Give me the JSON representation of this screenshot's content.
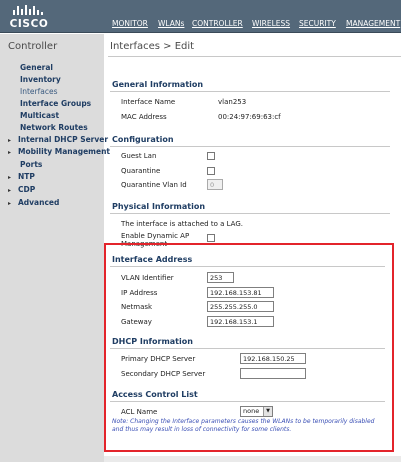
{
  "brand": {
    "logo_text": "CISCO"
  },
  "nav": {
    "items": [
      {
        "label": "MONITOR",
        "name": "nav-monitor"
      },
      {
        "label": "WLANs",
        "name": "nav-wlans"
      },
      {
        "label": "CONTROLLER",
        "name": "nav-controller"
      },
      {
        "label": "WIRELESS",
        "name": "nav-wireless"
      },
      {
        "label": "SECURITY",
        "name": "nav-security"
      },
      {
        "label": "MANAGEMENT",
        "name": "nav-management"
      }
    ]
  },
  "sidebar": {
    "title": "Controller",
    "items": [
      {
        "label": "General"
      },
      {
        "label": "Inventory"
      },
      {
        "label": "Interfaces"
      },
      {
        "label": "Interface Groups"
      },
      {
        "label": "Multicast"
      },
      {
        "label": "Network Routes"
      },
      {
        "label": "Internal DHCP Server",
        "expandable": true
      },
      {
        "label": "Mobility Management",
        "expandable": true
      },
      {
        "label": "Ports"
      },
      {
        "label": "NTP",
        "expandable": true
      },
      {
        "label": "CDP",
        "expandable": true
      },
      {
        "label": "Advanced",
        "expandable": true
      }
    ],
    "expand_glyph": "▸"
  },
  "page": {
    "title": "Interfaces > Edit"
  },
  "general": {
    "title": "General Information",
    "interface_name_label": "Interface Name",
    "interface_name_value": "vlan253",
    "mac_label": "MAC Address",
    "mac_value": "00:24:97:69:63:cf"
  },
  "configuration": {
    "title": "Configuration",
    "guest_lan_label": "Guest Lan",
    "quarantine_label": "Quarantine",
    "quarantine_vlan_label": "Quarantine Vlan Id",
    "quarantine_vlan_value": "0"
  },
  "physical": {
    "title": "Physical Information",
    "lag_text": "The interface is attached to a LAG.",
    "dynamic_ap_label_1": "Enable Dynamic AP",
    "dynamic_ap_label_2": "Management"
  },
  "interface_address": {
    "title": "Interface Address",
    "vlan_label": "VLAN Identifier",
    "vlan_value": "253",
    "ip_label": "IP Address",
    "ip_value": "192.168.153.81",
    "netmask_label": "Netmask",
    "netmask_value": "255.255.255.0",
    "gateway_label": "Gateway",
    "gateway_value": "192.168.153.1"
  },
  "dhcp": {
    "title": "DHCP Information",
    "primary_label": "Primary DHCP Server",
    "primary_value": "192.168.150.25",
    "secondary_label": "Secondary DHCP Server",
    "secondary_value": ""
  },
  "acl": {
    "title": "Access Control List",
    "name_label": "ACL Name",
    "name_value": "none"
  },
  "note": "Note: Changing the Interface parameters causes the WLANs to be temporarily disabled and thus may result in loss of connectivity for some clients.",
  "colors": {
    "topbar": "#54687a",
    "highlight": "#e3242b",
    "section_title": "#1f3d63",
    "note": "#3a4fb5"
  }
}
